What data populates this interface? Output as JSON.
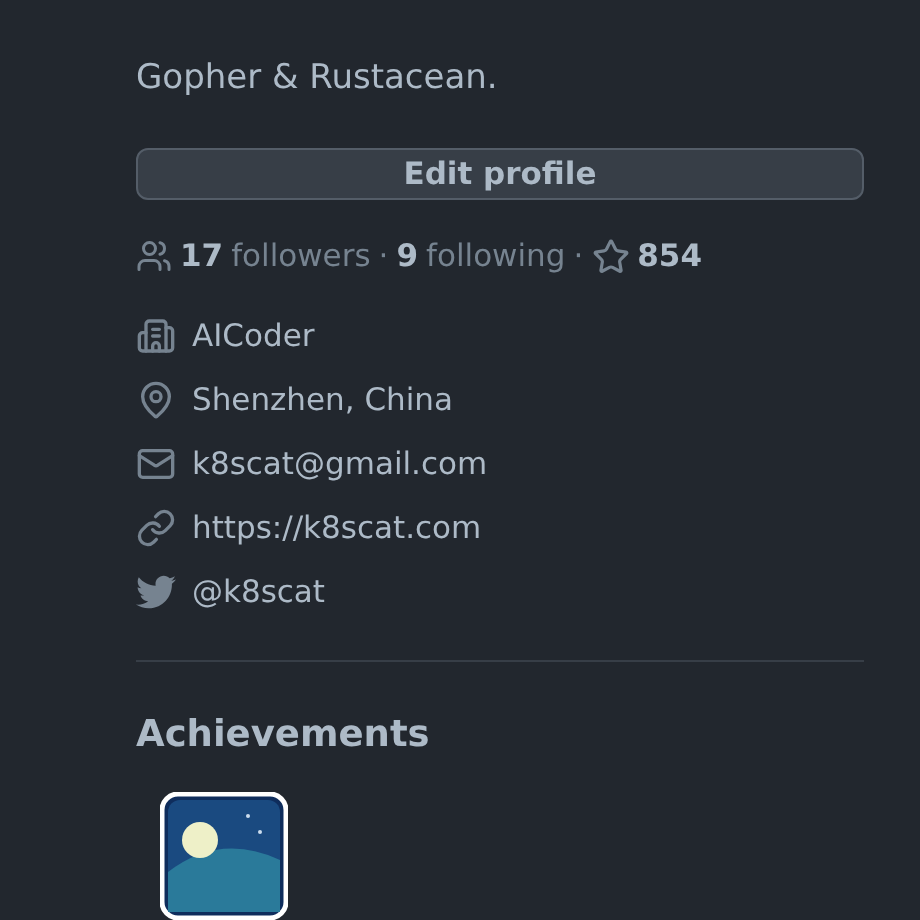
{
  "bio": "Gopher & Rustacean.",
  "edit_button": "Edit profile",
  "stats": {
    "followers_count": "17",
    "followers_label": "followers",
    "separator_1": "·",
    "following_count": "9",
    "following_label": "following",
    "separator_2": "·",
    "stars": "854"
  },
  "details": [
    {
      "kind": "organization",
      "text": "AICoder"
    },
    {
      "kind": "location",
      "text": "Shenzhen, China"
    },
    {
      "kind": "email",
      "text": "k8scat@gmail.com"
    },
    {
      "kind": "link",
      "text": "https://k8scat.com"
    },
    {
      "kind": "twitter",
      "text": "@k8scat"
    }
  ],
  "achievements": {
    "title": "Achievements"
  }
}
